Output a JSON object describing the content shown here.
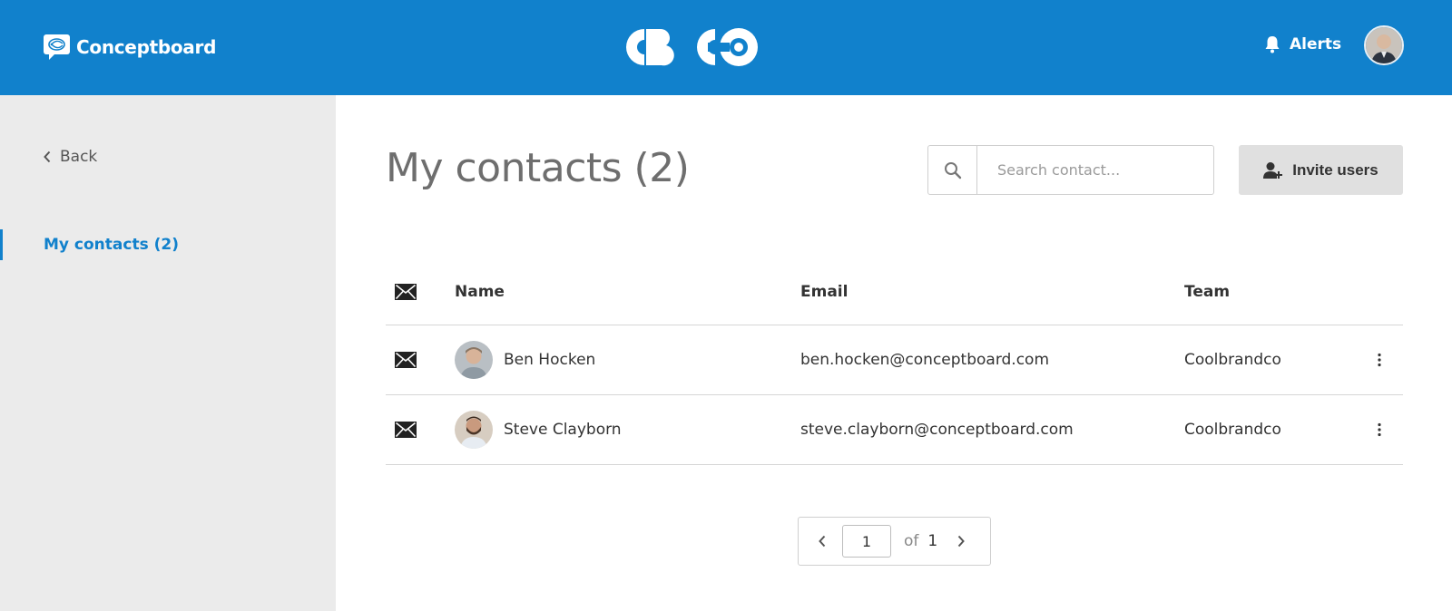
{
  "header": {
    "brand_name": "Conceptboard",
    "alerts_label": "Alerts",
    "accent_color": "#1181cc"
  },
  "sidebar": {
    "back_label": "Back",
    "items": [
      {
        "label": "My contacts (2)",
        "active": true
      }
    ]
  },
  "main": {
    "title": "My contacts (2)",
    "search": {
      "placeholder": "Search contact...",
      "value": ""
    },
    "invite_button_label": "Invite users"
  },
  "table": {
    "columns": [
      "Name",
      "Email",
      "Team"
    ],
    "rows": [
      {
        "name": "Ben Hocken",
        "email": "ben.hocken@conceptboard.com",
        "team": "Coolbrandco"
      },
      {
        "name": "Steve Clayborn",
        "email": "steve.clayborn@conceptboard.com",
        "team": "Coolbrandco"
      }
    ]
  },
  "pagination": {
    "current_page": "1",
    "of_label": "of",
    "total_pages": "1"
  }
}
